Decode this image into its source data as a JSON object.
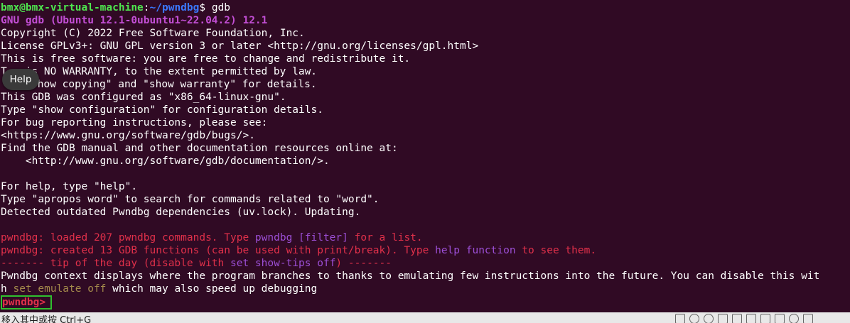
{
  "terminal": {
    "prompt_user_host": "bmx@bmx-virtual-machine",
    "prompt_colon": ":",
    "prompt_path": "~/pwndbg",
    "prompt_dollar_cmd": "$ gdb",
    "version_line": "GNU gdb (Ubuntu 12.1-0ubuntu1~22.04.2) 12.1",
    "lines": [
      "Copyright (C) 2022 Free Software Foundation, Inc.",
      "License GPLv3+: GNU GPL version 3 or later <http://gnu.org/licenses/gpl.html>",
      "This is free software: you are free to change and redistribute it.",
      "There is NO WARRANTY, to the extent permitted by law.",
      "Type \"show copying\" and \"show warranty\" for details.",
      "This GDB was configured as \"x86_64-linux-gnu\".",
      "Type \"show configuration\" for configuration details.",
      "For bug reporting instructions, please see:",
      "<https://www.gnu.org/software/gdb/bugs/>.",
      "Find the GDB manual and other documentation resources online at:",
      "    <http://www.gnu.org/software/gdb/documentation/>.",
      "",
      "For help, type \"help\".",
      "Type \"apropos word\" to search for commands related to \"word\".",
      "Detected outdated Pwndbg dependencies (uv.lock). Updating."
    ],
    "line3_visible": "T",
    "line3_rest": "is NO WARRANTY, to the extent permitted by law.",
    "line4_rest": "show copying\" and \"show warranty\" for details.",
    "pwndbg_prefix": "pwndbg:",
    "loaded_a": " loaded 207 pwndbg commands. Type ",
    "loaded_b": "pwndbg [filter]",
    "loaded_c": " for a list.",
    "created_a": " created 13 GDB functions (can be used with print/break). Type ",
    "created_b": "help function",
    "created_c": " to see them.",
    "tip_a": "------- tip of the day (disable with ",
    "tip_b": "set show-tips off",
    "tip_c": ") -------",
    "context_line": "Pwndbg context displays where the program branches to thanks to emulating few instructions into the future. You can disable this wit",
    "wrap_h": "h ",
    "wrap_set": "set emulate off",
    "wrap_rest": " which may also speed up debugging",
    "final_prompt": "pwndbg>"
  },
  "tooltip": {
    "label": "Help"
  },
  "statusbar": {
    "text": "移入其中或按 Ctrl+G"
  }
}
